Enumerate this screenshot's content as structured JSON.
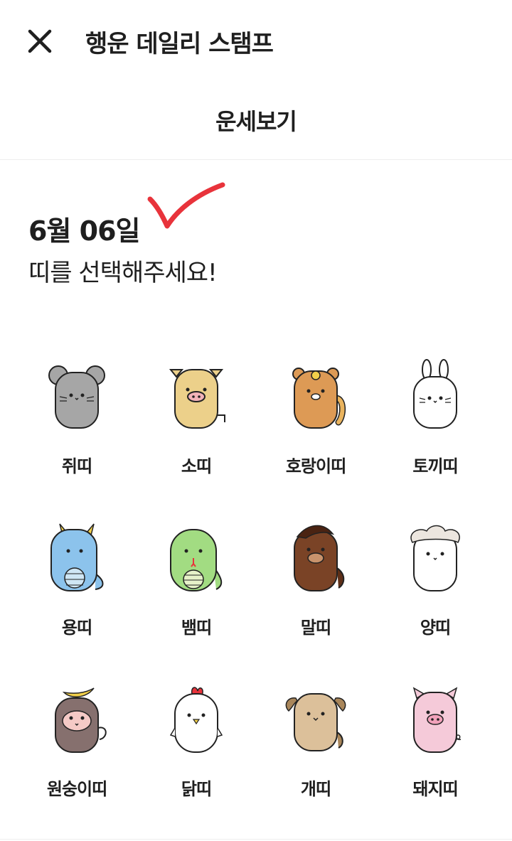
{
  "header": {
    "close_icon": "close-icon",
    "app_title": "행운 데일리 스탬프"
  },
  "page": {
    "title": "운세보기",
    "date": "6월 06일",
    "prompt": "띠를 선택해주세요!",
    "check_color": "#e8333b"
  },
  "zodiac": [
    {
      "label": "쥐띠",
      "icon": "rat-icon",
      "color": "#a6a6a6"
    },
    {
      "label": "소띠",
      "icon": "ox-icon",
      "color": "#ecd08a"
    },
    {
      "label": "호랑이띠",
      "icon": "tiger-icon",
      "color": "#dd9a55"
    },
    {
      "label": "토끼띠",
      "icon": "rabbit-icon",
      "color": "#ffffff"
    },
    {
      "label": "용띠",
      "icon": "dragon-icon",
      "color": "#8cc3ec"
    },
    {
      "label": "뱀띠",
      "icon": "snake-icon",
      "color": "#a2dc82"
    },
    {
      "label": "말띠",
      "icon": "horse-icon",
      "color": "#7a4326"
    },
    {
      "label": "양띠",
      "icon": "sheep-icon",
      "color": "#ffffff"
    },
    {
      "label": "원숭이띠",
      "icon": "monkey-icon",
      "color": "#86706e"
    },
    {
      "label": "닭띠",
      "icon": "rooster-icon",
      "color": "#ffffff"
    },
    {
      "label": "개띠",
      "icon": "dog-icon",
      "color": "#dcc09a"
    },
    {
      "label": "돼지띠",
      "icon": "pig-icon",
      "color": "#f5cad9"
    }
  ]
}
